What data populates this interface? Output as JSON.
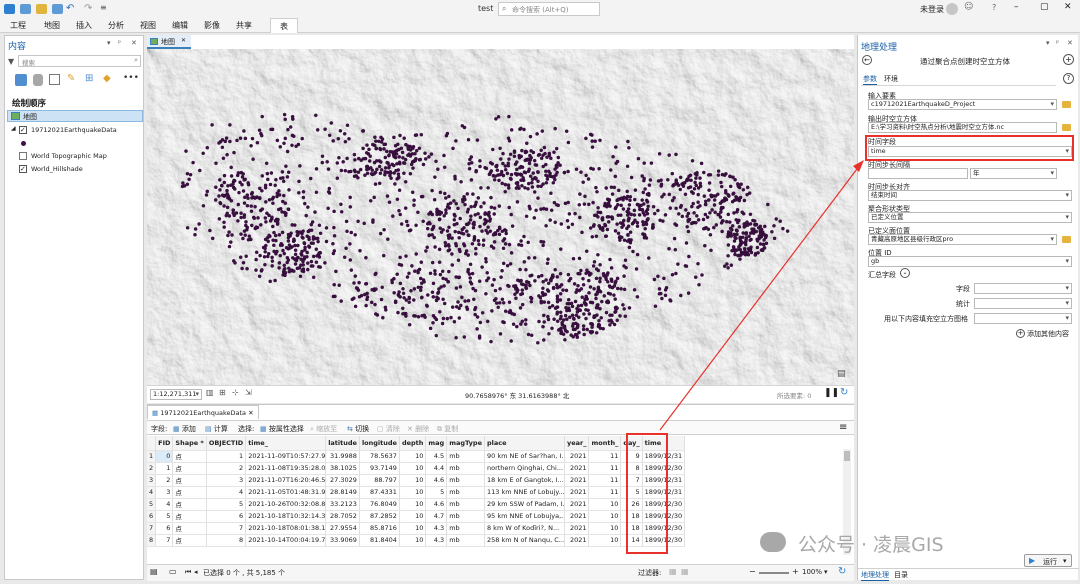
{
  "app": {
    "project_name": "test",
    "search_placeholder": "命令搜索 (Alt+Q)",
    "user": "未登录",
    "help": "?"
  },
  "ribbon": {
    "tabs": [
      "工程",
      "地图",
      "插入",
      "分析",
      "视图",
      "编辑",
      "影像",
      "共享",
      "表"
    ],
    "active_tab": "表"
  },
  "contents": {
    "title": "内容",
    "search_placeholder": "搜索",
    "section": "绘制顺序",
    "map_item": "地图",
    "layers": [
      {
        "name": "19712021EarthquakeData",
        "checked": true
      },
      {
        "name": "World Topographic Map",
        "checked": false
      },
      {
        "name": "World_Hillshade",
        "checked": true
      }
    ]
  },
  "map": {
    "tab_label": "地图",
    "scale": "1:12,271,311",
    "coordinates": "90.7658976° 东 31.6163988° 北",
    "selected_features": "所选要素: 0",
    "point_color": "#3f0f45"
  },
  "attribute_table": {
    "tab_label": "19712021EarthquakeData",
    "toolbar": {
      "field_label": "字段:",
      "add": "添加",
      "calculate": "计算",
      "selection_label": "选择:",
      "select_by_attributes": "按属性选择",
      "zoom_to": "缩放至",
      "switch": "切换",
      "clear": "清除",
      "delete": "删除",
      "copy": "复制"
    },
    "columns": [
      "FID",
      "Shape *",
      "OBJECTID",
      "time_",
      "latitude",
      "longitude",
      "depth",
      "mag",
      "magType",
      "place",
      "year_",
      "month_",
      "day_",
      "time"
    ],
    "rows": [
      [
        "0",
        "点",
        "1",
        "2021-11-09T10:57:27.9...",
        "31.9988",
        "78.5637",
        "10",
        "4.5",
        "mb",
        "90 km NE of Sar?han, I...",
        "2021",
        "11",
        "9",
        "1899/12/31"
      ],
      [
        "1",
        "点",
        "2",
        "2021-11-08T19:35:28.0...",
        "38.1025",
        "93.7149",
        "10",
        "4.4",
        "mb",
        "northern Qinghai, Chi...",
        "2021",
        "11",
        "8",
        "1899/12/30"
      ],
      [
        "2",
        "点",
        "3",
        "2021-11-07T16:20:46.5...",
        "27.3029",
        "88.797",
        "10",
        "4.6",
        "mb",
        "18 km E of Gangtok, I...",
        "2021",
        "11",
        "7",
        "1899/12/31"
      ],
      [
        "3",
        "点",
        "4",
        "2021-11-05T01:48:31.9...",
        "28.8149",
        "87.4331",
        "10",
        "5",
        "mb",
        "113 km NNE of Lobujy...",
        "2021",
        "11",
        "5",
        "1899/12/31"
      ],
      [
        "4",
        "点",
        "5",
        "2021-10-26T00:32:08.8...",
        "33.2123",
        "76.8049",
        "10",
        "4.6",
        "mb",
        "29 km SSW of Padam, I...",
        "2021",
        "10",
        "26",
        "1899/12/30"
      ],
      [
        "5",
        "点",
        "6",
        "2021-10-18T10:32:14.3...",
        "28.7052",
        "87.2852",
        "10",
        "4.7",
        "mb",
        "95 km NNE of Lobujya,...",
        "2021",
        "10",
        "18",
        "1899/12/30"
      ],
      [
        "6",
        "点",
        "7",
        "2021-10-18T08:01:38.1...",
        "27.9554",
        "85.8716",
        "10",
        "4.3",
        "mb",
        "8 km W of Kodīri?, N...",
        "2021",
        "10",
        "18",
        "1899/12/30"
      ],
      [
        "7",
        "点",
        "8",
        "2021-10-14T00:04:19.7...",
        "33.9069",
        "81.8404",
        "10",
        "4.3",
        "mb",
        "258 km N of Nanqu, C...",
        "2021",
        "10",
        "14",
        "1899/12/30"
      ]
    ],
    "status": "已选择 0 个 , 共 5,185 个",
    "filter_label": "过滤器:",
    "zoom": "100%"
  },
  "geoprocessing": {
    "pane_title": "地理处理",
    "tool_title": "通过聚合点创建时空立方体",
    "tabs": [
      "参数",
      "环境"
    ],
    "params": {
      "input_label": "输入要素",
      "input_value": "c19712021EarthquakeD_Project",
      "output_label": "输出时空立方体",
      "output_value": "E:\\学习资料\\时空热点分析\\地震时空立方体.nc",
      "time_field_label": "时间字段",
      "time_field_value": "time",
      "interval_label": "时间步长间隔",
      "interval_unit": "年",
      "alignment_label": "时间步长对齐",
      "alignment_value": "结束时间",
      "shape_label": "聚合形状类型",
      "shape_value": "已定义位置",
      "defined_label": "已定义面位置",
      "defined_value": "青藏高原地区县级行政区pro",
      "id_label": "位置 ID",
      "id_value": "gb",
      "summary_label": "汇总字段",
      "sub_field": "字段",
      "sub_stat": "统计",
      "sub_fill": "用以下内容填充空立方图格",
      "add_more": "添加其他内容"
    },
    "run": "运行",
    "bottom_tabs": [
      "地理处理",
      "目录"
    ]
  },
  "watermark": "公众号 · 凌晨GIS",
  "highlight_color": "#e8312a"
}
